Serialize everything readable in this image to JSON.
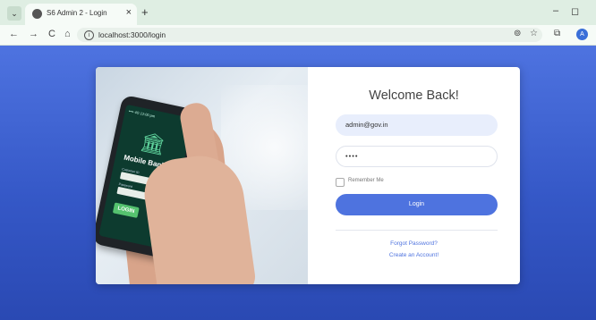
{
  "browser": {
    "tab_title": "S6 Admin 2 - Login",
    "new_tab_glyph": "+",
    "close_glyph": "×",
    "url": "localhost:3000/login",
    "nav": {
      "back": "←",
      "forward": "→",
      "reload": "C",
      "home": "⌂"
    },
    "tools": {
      "lens": "⊚",
      "star": "☆",
      "extensions": "⧉"
    },
    "window": {
      "minimize": "–",
      "maximize": "◻"
    },
    "profile_initial": "A"
  },
  "hero": {
    "status": "•••• 4G  12:00 pm",
    "bank_title": "Mobile Banking",
    "field1_label": "Customer ID",
    "field2_label": "Password",
    "button_label": "LOGIN"
  },
  "login": {
    "heading": "Welcome Back!",
    "email_value": "admin@gov.in",
    "password_value": "••••",
    "remember_label": "Remember Me",
    "button_label": "Login",
    "forgot_link": "Forgot Password?",
    "create_link": "Create an Account!"
  },
  "colors": {
    "primary": "#4e73df",
    "background": "#3558c7"
  }
}
